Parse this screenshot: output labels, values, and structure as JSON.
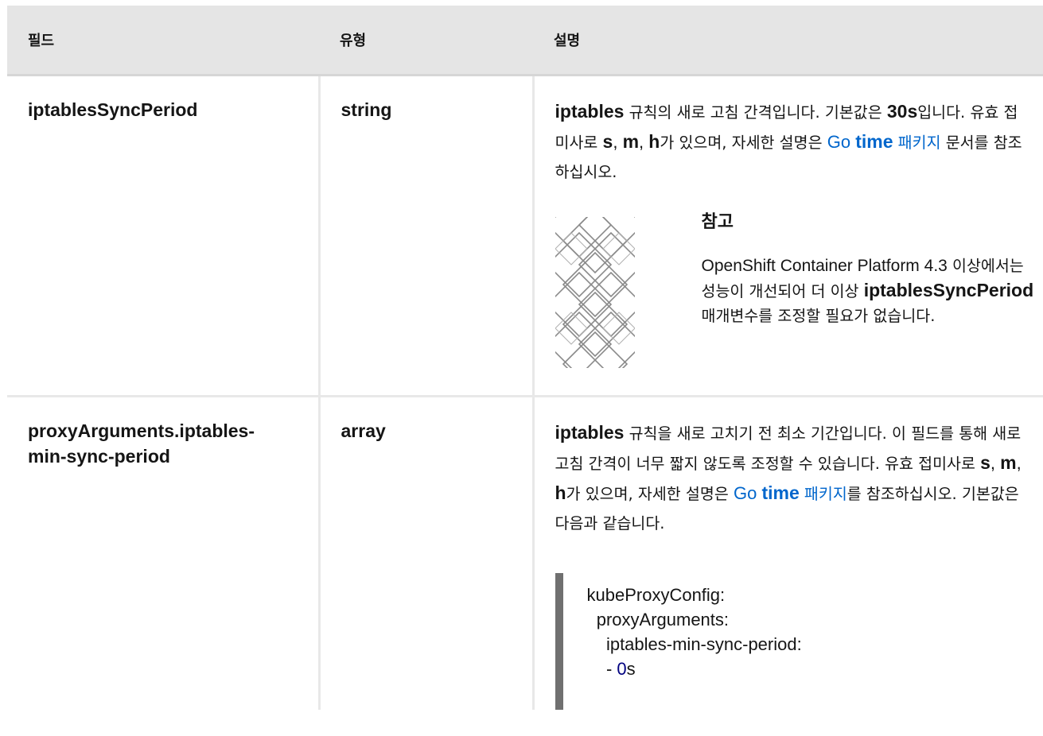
{
  "table": {
    "headers": {
      "field": "필드",
      "type": "유형",
      "description": "설명"
    },
    "rows": [
      {
        "field": "iptablesSyncPeriod",
        "type": "string",
        "desc": {
          "p1": "iptables",
          "p2": " 규칙의 새로 고침 간격입니다. 기본값은 ",
          "p3": "30s",
          "p4": "입니다. 유효 접미사로 ",
          "s": "s",
          "comma1": ", ",
          "m": "m",
          "comma2": ", ",
          "h": "h",
          "p5": "가 있으며, 자세한 설명은 ",
          "link_go": "Go ",
          "link_time": "time",
          "link_pkg": " 패키지",
          "p6": " 문서를 참조하십시오."
        },
        "note": {
          "title": "참고",
          "t1": "OpenShift Container Platform 4.3",
          "t2": " 이상에서는 성능이 개선되어 더 이상 ",
          "t3": "iptablesSyncPeriod",
          "t4": " 매개변수를 조정할 필요가 없습니다."
        }
      },
      {
        "field_line1": "proxyArguments.iptables-",
        "field_line2": "min-sync-period",
        "type": "array",
        "desc": {
          "p1": "iptables",
          "p2": " 규칙을 새로 고치기 전 최소 기간입니다. 이 필드를 통해 새로 고침 간격이 너무 짧지 않도록 조정할 수 있습니다. 유효 접미사로 ",
          "s": "s",
          "comma1": ", ",
          "m": "m",
          "comma2": ", ",
          "h": "h",
          "p3": "가 있으며, 자세한 설명은 ",
          "link_go": "Go ",
          "link_time": "time",
          "link_pkg": " 패키지",
          "p4": "를 참조하십시오. 기본값은 다음과 같습니다."
        },
        "code": {
          "line1": "kubeProxyConfig:",
          "line2": "  proxyArguments:",
          "line3": "    iptables-min-sync-period:",
          "line4_prefix": "    - ",
          "line4_num": "0",
          "line4_suffix": "s"
        }
      }
    ]
  },
  "colors": {
    "header_bg": "#e5e5e5",
    "link": "#0066cc",
    "code_bar": "#707070",
    "code_number": "#000080"
  },
  "icons": {
    "note": "note-pattern-icon"
  }
}
